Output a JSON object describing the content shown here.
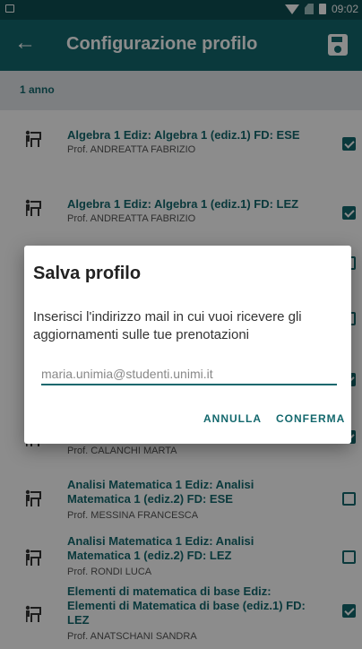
{
  "status_bar": {
    "time": "09:02"
  },
  "app_bar": {
    "title": "Configurazione profilo"
  },
  "section": {
    "label": "1 anno"
  },
  "courses": [
    {
      "name": "Algebra 1 Ediz: Algebra 1 (ediz.1) FD: ESE",
      "prof": "Prof. ANDREATTA FABRIZIO",
      "checked": true
    },
    {
      "name": "Algebra 1 Ediz: Algebra 1 (ediz.1) FD: LEZ",
      "prof": "Prof. ANDREATTA FABRIZIO",
      "checked": true
    },
    {
      "name": "",
      "prof": "Prof. CALANCHI MARTA",
      "checked": true
    },
    {
      "name": "Analisi Matematica 1 Ediz: Analisi Matematica 1 (ediz.2) FD: ESE",
      "prof": "Prof. MESSINA FRANCESCA",
      "checked": false
    },
    {
      "name": "Analisi Matematica 1 Ediz: Analisi Matematica 1 (ediz.2) FD: LEZ",
      "prof": "Prof. RONDI LUCA",
      "checked": false
    },
    {
      "name": "Elementi di matematica di base Ediz: Elementi di Matematica di base (ediz.1) FD: LEZ",
      "prof": "Prof. ANATSCHANI SANDRA",
      "checked": true
    }
  ],
  "dialog": {
    "title": "Salva profilo",
    "message": "Inserisci l'indirizzo mail in cui vuoi ricevere gli aggiornamenti sulle tue prenotazioni",
    "email_value": "maria.unimia@studenti.unimi.it",
    "cancel_label": "ANNULLA",
    "confirm_label": "CONFERMA"
  },
  "colors": {
    "primary": "#13686d",
    "status_bar": "#0e4f52",
    "section_bg": "#e4e7eb"
  }
}
